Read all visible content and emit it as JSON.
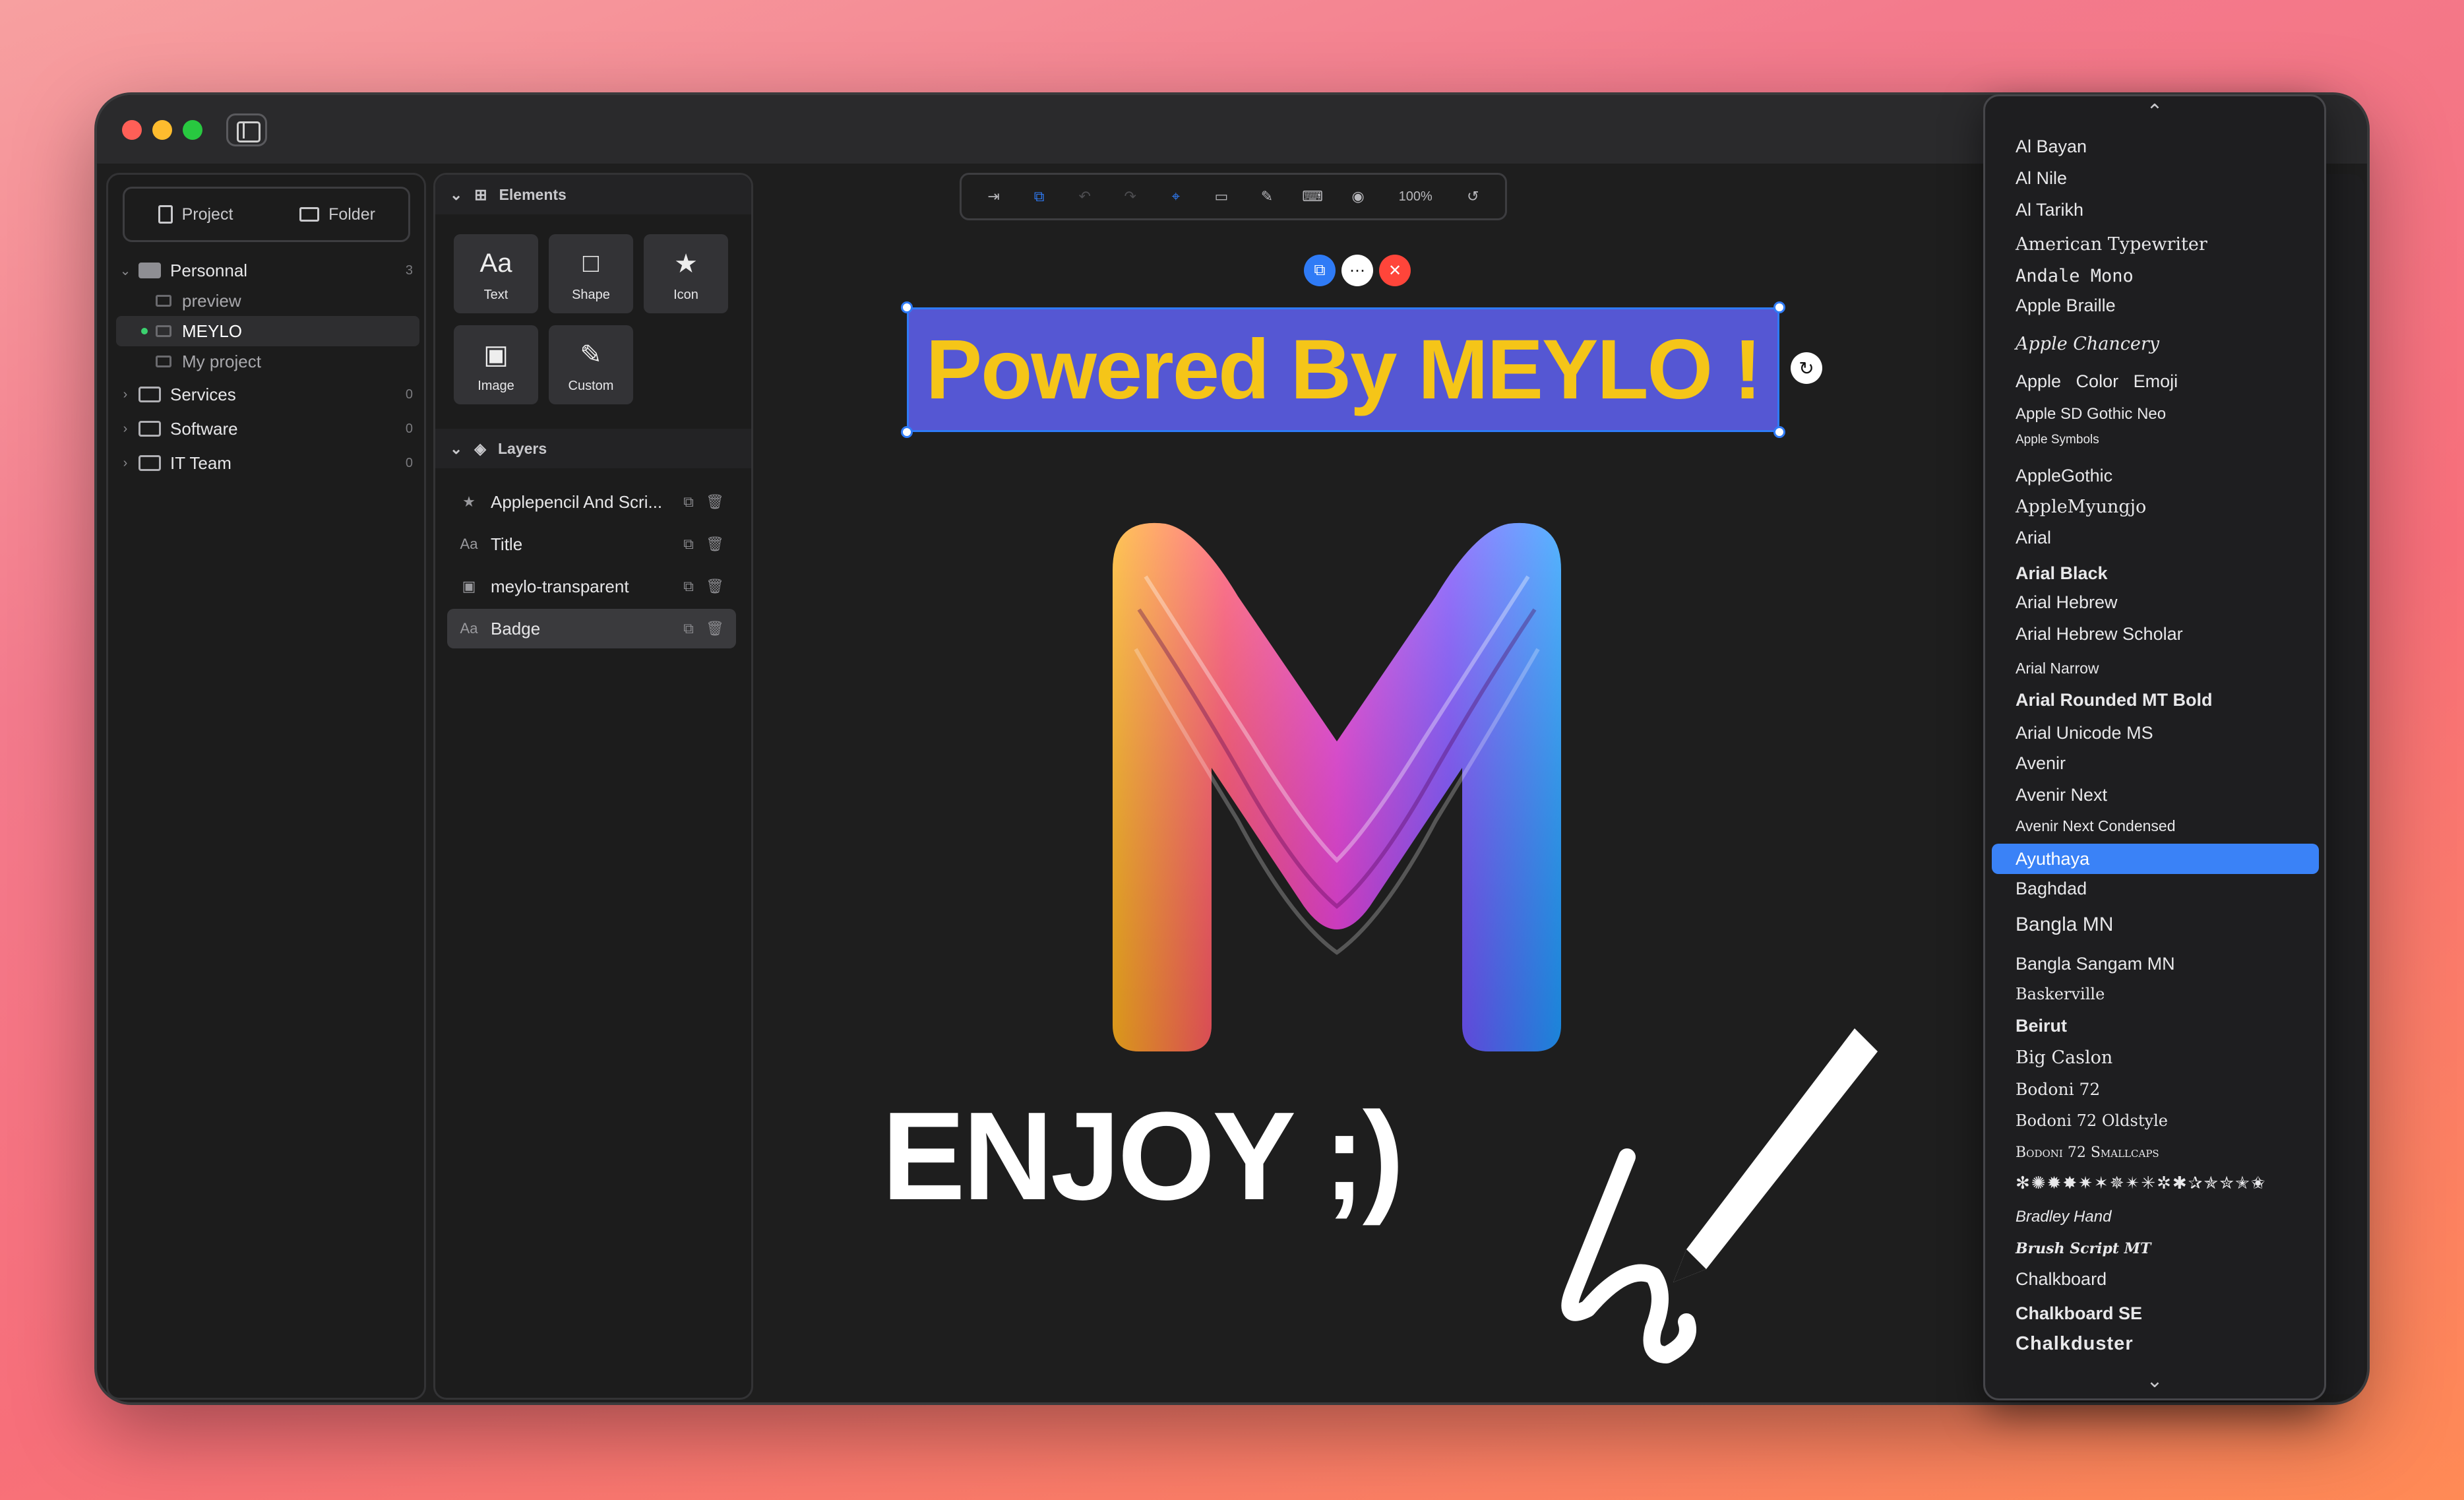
{
  "sidebar": {
    "project_tab": "Project",
    "folder_tab": "Folder",
    "tree": [
      {
        "label": "Personnal",
        "count": "3",
        "expanded": true,
        "children": [
          "preview",
          "MEYLO",
          "My project"
        ]
      },
      {
        "label": "Services",
        "count": "0"
      },
      {
        "label": "Software",
        "count": "0"
      },
      {
        "label": "IT Team",
        "count": "0"
      }
    ],
    "selected_child": "MEYLO"
  },
  "elements": {
    "title": "Elements",
    "tiles": [
      {
        "glyph": "Aa",
        "label": "Text"
      },
      {
        "glyph": "□",
        "label": "Shape"
      },
      {
        "glyph": "★",
        "label": "Icon"
      },
      {
        "glyph": "▣",
        "label": "Image"
      },
      {
        "glyph": "✎",
        "label": "Custom"
      }
    ]
  },
  "layers": {
    "title": "Layers",
    "items": [
      {
        "icon": "★",
        "label": "Applepencil And Scri..."
      },
      {
        "icon": "Aa",
        "label": "Title"
      },
      {
        "icon": "▣",
        "label": "meylo-transparent"
      },
      {
        "icon": "Aa",
        "label": "Badge"
      }
    ],
    "selected": "Badge"
  },
  "toolbar": {
    "zoom": "100%"
  },
  "canvas": {
    "banner_text": "Powered By MEYLO !",
    "enjoy_text": "ENJOY ;)",
    "banner_bg": "#5557d3",
    "banner_text_color": "#f5c518"
  },
  "font_menu": {
    "items": [
      "Al Bayan",
      "Al Nile",
      "Al Tarikh",
      "American Typewriter",
      "Andale Mono",
      "Apple Braille",
      "Apple Chancery",
      "Apple   Color   Emoji",
      "Apple SD Gothic Neo",
      "Apple Symbols",
      "AppleGothic",
      "AppleMyungjo",
      "Arial",
      "Arial Black",
      "Arial Hebrew",
      "Arial Hebrew Scholar",
      "Arial Narrow",
      "Arial Rounded MT Bold",
      "Arial Unicode MS",
      "Avenir",
      "Avenir Next",
      "Avenir Next Condensed",
      "Ayuthaya",
      "Baghdad",
      "Bangla MN",
      "Bangla Sangam MN",
      "Baskerville",
      "Beirut",
      "Big Caslon",
      "Bodoni 72",
      "Bodoni 72 Oldstyle",
      "Bodoni 72 Smallcaps",
      "✻✺✹✸✷✶✵✴✳✲✱✰✯✮✭✬",
      "Bradley Hand",
      "Brush Script MT",
      "Chalkboard",
      "Chalkboard SE",
      "Chalkduster"
    ],
    "selected": "Ayuthaya",
    "accent": "#3a82f7"
  }
}
